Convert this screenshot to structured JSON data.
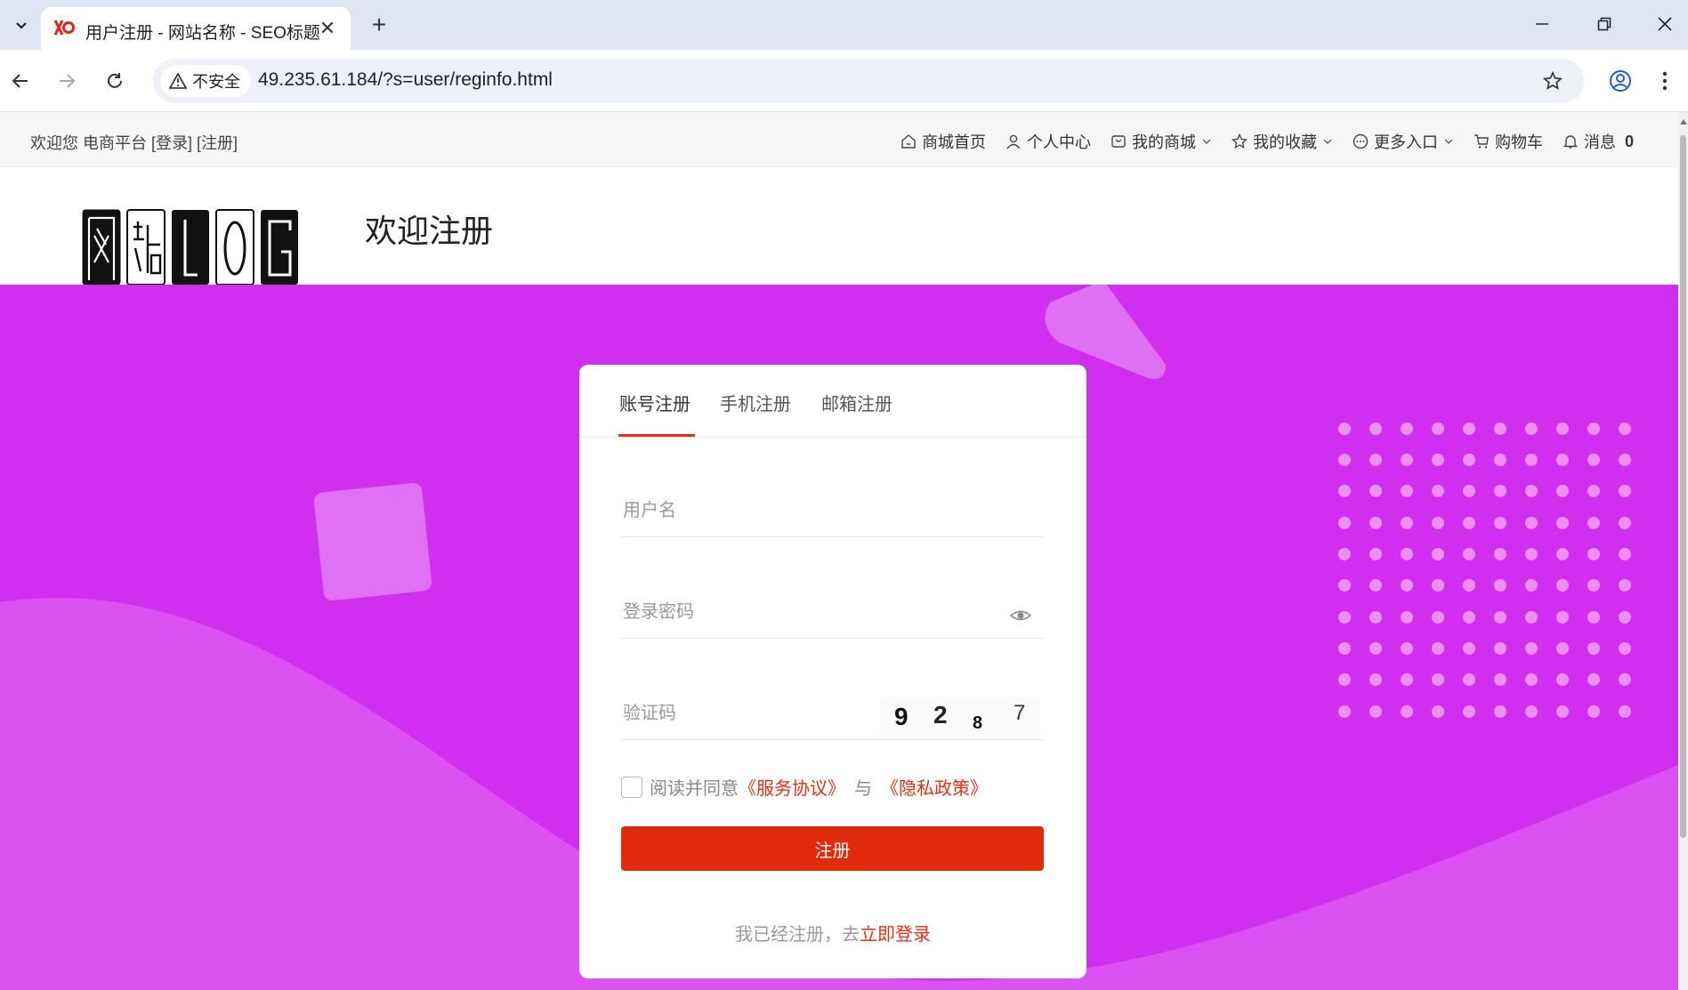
{
  "browser": {
    "tab_title": "用户注册 - 网站名称 - SEO标题",
    "security_label": "不安全",
    "url": "49.235.61.184/?s=user/reginfo.html"
  },
  "topbar": {
    "welcome": "欢迎您 电商平台 [登录] [注册]",
    "nav": [
      {
        "label": "商城首页",
        "icon": "home-icon"
      },
      {
        "label": "个人中心",
        "icon": "user-icon"
      },
      {
        "label": "我的商城",
        "icon": "store-icon",
        "dropdown": true
      },
      {
        "label": "我的收藏",
        "icon": "star-icon",
        "dropdown": true
      },
      {
        "label": "更多入口",
        "icon": "more-icon",
        "dropdown": true
      },
      {
        "label": "购物车",
        "icon": "cart-icon"
      },
      {
        "label": "消息",
        "icon": "bell-icon",
        "count": "0"
      }
    ]
  },
  "header": {
    "title": "欢迎注册",
    "logo_text": "网站LOG"
  },
  "form": {
    "tabs": [
      "账号注册",
      "手机注册",
      "邮箱注册"
    ],
    "active_tab": "账号注册",
    "username_placeholder": "用户名",
    "password_placeholder": "登录密码",
    "captcha_placeholder": "验证码",
    "captcha_chars": [
      "9",
      "2",
      "8",
      "7"
    ],
    "agree_prefix": "阅读并同意",
    "agree_terms": "《服务协议》",
    "agree_sep": "与",
    "agree_privacy": "《隐私政策》",
    "submit": "注册",
    "have_account": "我已经注册，去",
    "login_link": "立即登录"
  },
  "colors": {
    "hero": "#d12ff0",
    "accent": "#e12a0c"
  }
}
